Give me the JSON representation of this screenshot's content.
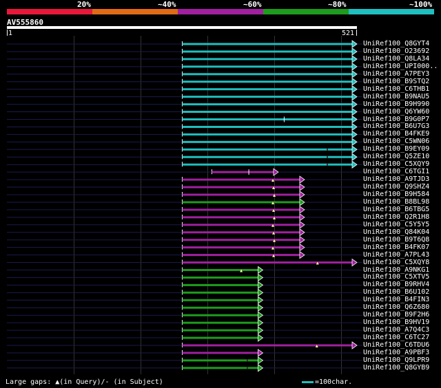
{
  "legend": {
    "labels": [
      "20%",
      "~40%",
      "~60%",
      "~80%",
      "~100%"
    ],
    "colors": [
      "#e8183a",
      "#e06b17",
      "#a020a0",
      "#1d9c1d",
      "#1fbfbf"
    ]
  },
  "query": {
    "id": "AV555860",
    "start": "1",
    "end": "521",
    "length": 521
  },
  "colors": {
    "background": "#000000",
    "grid": "#333333",
    "cyan": "#1fbfbf",
    "magenta": "#a020a0",
    "green": "#1d9c1d",
    "hit_line": "#1a1a50"
  },
  "hits": [
    {
      "name": "UniRef100_Q8GYT4",
      "identity": "cyan",
      "q_start": 262,
      "q_end": 521,
      "arrow": "right"
    },
    {
      "name": "UniRef100_O23692",
      "identity": "cyan",
      "q_start": 262,
      "q_end": 521,
      "arrow": "right"
    },
    {
      "name": "UniRef100_Q8LA34",
      "identity": "cyan",
      "q_start": 262,
      "q_end": 521,
      "arrow": "right"
    },
    {
      "name": "UniRef100_UPI000..",
      "identity": "cyan",
      "q_start": 262,
      "q_end": 521,
      "arrow": "right"
    },
    {
      "name": "UniRef100_A7PEY3",
      "identity": "cyan",
      "q_start": 262,
      "q_end": 521,
      "arrow": "right"
    },
    {
      "name": "UniRef100_B9STQ2",
      "identity": "cyan",
      "q_start": 262,
      "q_end": 521,
      "arrow": "right"
    },
    {
      "name": "UniRef100_C6THB1",
      "identity": "cyan",
      "q_start": 262,
      "q_end": 521,
      "arrow": "right"
    },
    {
      "name": "UniRef100_B9NAU5",
      "identity": "cyan",
      "q_start": 262,
      "q_end": 521,
      "arrow": "right"
    },
    {
      "name": "UniRef100_B9H990",
      "identity": "cyan",
      "q_start": 262,
      "q_end": 521,
      "arrow": "right"
    },
    {
      "name": "UniRef100_Q6YW60",
      "identity": "cyan",
      "q_start": 262,
      "q_end": 521,
      "arrow": "right"
    },
    {
      "name": "UniRef100_B9G0P7",
      "identity": "cyan",
      "q_start": 262,
      "q_end": 521,
      "arrow": "right",
      "subj_gap": true
    },
    {
      "name": "UniRef100_B6U7G3",
      "identity": "cyan",
      "q_start": 262,
      "q_end": 521,
      "arrow": "right"
    },
    {
      "name": "UniRef100_B4FKE9",
      "identity": "cyan",
      "q_start": 262,
      "q_end": 521,
      "arrow": "right"
    },
    {
      "name": "UniRef100_C5WN06",
      "identity": "cyan",
      "q_start": 262,
      "q_end": 521,
      "arrow": "right"
    },
    {
      "name": "UniRef100_B9EY09",
      "identity": "cyan",
      "q_start": 262,
      "q_end": 521,
      "arrow": "right",
      "dark_mark": true
    },
    {
      "name": "UniRef100_Q5ZE10",
      "identity": "cyan",
      "q_start": 262,
      "q_end": 521,
      "arrow": "right",
      "dark_mark": true
    },
    {
      "name": "UniRef100_C5XQY9",
      "identity": "cyan",
      "q_start": 262,
      "q_end": 521,
      "arrow": "right",
      "dark_mark": true
    },
    {
      "name": "UniRef100_C6TGI1",
      "identity": "magenta",
      "q_start": 306,
      "q_end": 404,
      "arrow": "right",
      "subj_gap": true
    },
    {
      "name": "UniRef100_A9TJD3",
      "identity": "magenta",
      "q_start": 262,
      "q_end": 443,
      "arrow": "right",
      "ins": true
    },
    {
      "name": "UniRef100_Q9SHZ4",
      "identity": "magenta",
      "q_start": 262,
      "q_end": 443,
      "arrow": "right",
      "ins": true
    },
    {
      "name": "UniRef100_B9H584",
      "identity": "magenta",
      "q_start": 262,
      "q_end": 443,
      "arrow": "right",
      "ins": true
    },
    {
      "name": "UniRef100_B8BL98",
      "identity": "green",
      "q_start": 262,
      "q_end": 443,
      "arrow": "right",
      "ins": true
    },
    {
      "name": "UniRef100_B6TBG5",
      "identity": "magenta",
      "q_start": 262,
      "q_end": 443,
      "arrow": "right",
      "ins": true
    },
    {
      "name": "UniRef100_Q2R1H8",
      "identity": "magenta",
      "q_start": 262,
      "q_end": 443,
      "arrow": "right",
      "ins": true
    },
    {
      "name": "UniRef100_C5Y5Y5",
      "identity": "magenta",
      "q_start": 262,
      "q_end": 443,
      "arrow": "right",
      "ins": true
    },
    {
      "name": "UniRef100_Q84K04",
      "identity": "magenta",
      "q_start": 262,
      "q_end": 443,
      "arrow": "right",
      "ins": true
    },
    {
      "name": "UniRef100_B9T6Q8",
      "identity": "magenta",
      "q_start": 262,
      "q_end": 443,
      "arrow": "right",
      "ins": true
    },
    {
      "name": "UniRef100_B4FK07",
      "identity": "magenta",
      "q_start": 262,
      "q_end": 443,
      "arrow": "right",
      "ins": true
    },
    {
      "name": "UniRef100_A7PL43",
      "identity": "magenta",
      "q_start": 262,
      "q_end": 443,
      "arrow": "right",
      "ins": true
    },
    {
      "name": "UniRef100_C5XQY8",
      "identity": "magenta",
      "q_start": 262,
      "q_end": 521,
      "arrow": "right",
      "ins": true
    },
    {
      "name": "UniRef100_A9NKG1",
      "identity": "green",
      "q_start": 262,
      "q_end": 381,
      "arrow": "right",
      "ins": true
    },
    {
      "name": "UniRef100_C5XTV5",
      "identity": "green",
      "q_start": 262,
      "q_end": 381,
      "arrow": "right"
    },
    {
      "name": "UniRef100_B9RHV4",
      "identity": "green",
      "q_start": 262,
      "q_end": 381,
      "arrow": "right"
    },
    {
      "name": "UniRef100_B6U102",
      "identity": "green",
      "q_start": 262,
      "q_end": 381,
      "arrow": "right"
    },
    {
      "name": "UniRef100_B4FIN3",
      "identity": "green",
      "q_start": 262,
      "q_end": 381,
      "arrow": "right"
    },
    {
      "name": "UniRef100_Q6Z680",
      "identity": "green",
      "q_start": 262,
      "q_end": 381,
      "arrow": "right"
    },
    {
      "name": "UniRef100_B9F2H6",
      "identity": "green",
      "q_start": 262,
      "q_end": 381,
      "arrow": "right"
    },
    {
      "name": "UniRef100_B9HV19",
      "identity": "green",
      "q_start": 262,
      "q_end": 381,
      "arrow": "right"
    },
    {
      "name": "UniRef100_A7Q4C3",
      "identity": "green",
      "q_start": 262,
      "q_end": 381,
      "arrow": "right"
    },
    {
      "name": "UniRef100_C6TC27",
      "identity": "green",
      "q_start": 262,
      "q_end": 381,
      "arrow": "right"
    },
    {
      "name": "UniRef100_C6TDU6",
      "identity": "magenta",
      "q_start": 262,
      "q_end": 521,
      "arrow": "right",
      "ins": true
    },
    {
      "name": "UniRef100_A9PBF3",
      "identity": "magenta",
      "q_start": 262,
      "q_end": 381,
      "arrow": "right"
    },
    {
      "name": "UniRef100_Q9LPR9",
      "identity": "green",
      "q_start": 262,
      "q_end": 381,
      "arrow": "right",
      "dark_mark": true
    },
    {
      "name": "UniRef100_Q8GYB9",
      "identity": "green",
      "q_start": 262,
      "q_end": 381,
      "arrow": "right",
      "dark_mark": true
    }
  ],
  "footer": {
    "gaps_text": "Large gaps: ▲(in Query)/- (in Subject)",
    "scale_text": "=100char."
  }
}
